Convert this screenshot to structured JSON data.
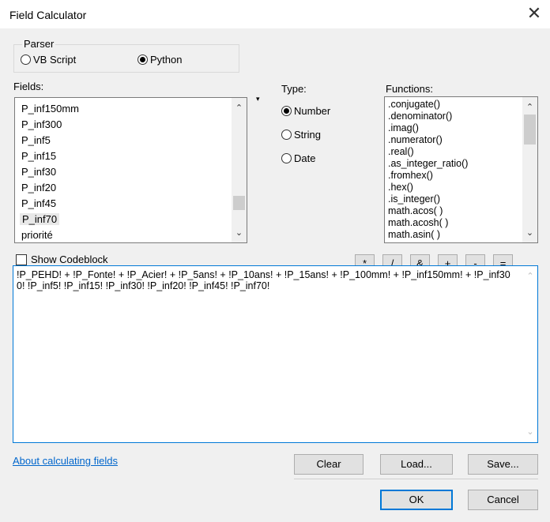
{
  "window": {
    "title": "Field Calculator",
    "close_glyph": "✕"
  },
  "parser": {
    "label": "Parser",
    "options": [
      {
        "label": "VB Script",
        "selected": false
      },
      {
        "label": "Python",
        "selected": true
      }
    ]
  },
  "fields": {
    "label": "Fields:",
    "items": [
      "P_inf150mm",
      "P_inf300",
      "P_inf5",
      "P_inf15",
      "P_inf30",
      "P_inf20",
      "P_inf45",
      "P_inf70",
      "priorité"
    ],
    "selected_index": 7
  },
  "type": {
    "label": "Type:",
    "options": [
      {
        "label": "Number",
        "selected": true
      },
      {
        "label": "String",
        "selected": false
      },
      {
        "label": "Date",
        "selected": false
      }
    ]
  },
  "functions": {
    "label": "Functions:",
    "items": [
      ".conjugate()",
      ".denominator()",
      ".imag()",
      ".numerator()",
      ".real()",
      ".as_integer_ratio()",
      ".fromhex()",
      ".hex()",
      ".is_integer()",
      "math.acos( )",
      "math.acosh( )",
      "math.asin( )"
    ]
  },
  "codeblock": {
    "label": "Show Codeblock",
    "checked": false
  },
  "equals_label": "=",
  "operators": [
    "*",
    "/",
    "&",
    "+",
    "-",
    "="
  ],
  "expression": "!P_PEHD! + !P_Fonte! + !P_Acier! + !P_5ans! + !P_10ans! + !P_15ans! + !P_100mm! + !P_inf150mm! + !P_inf300! !P_inf5! !P_inf15! !P_inf30! !P_inf20! !P_inf45! !P_inf70!",
  "help_link": "About calculating fields",
  "buttons": {
    "clear": "Clear",
    "load": "Load...",
    "save": "Save...",
    "ok": "OK",
    "cancel": "Cancel"
  },
  "colors": {
    "accent": "#0078d7",
    "link": "#0066cc",
    "dialog_bg": "#f0f0f0"
  }
}
